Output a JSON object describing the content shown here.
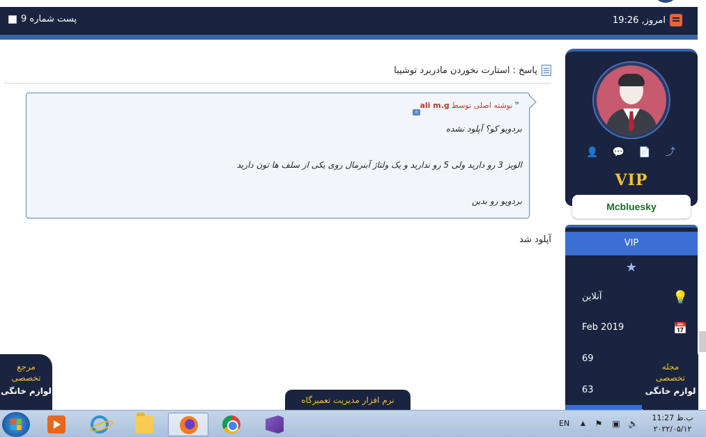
{
  "post": {
    "number_label": "پست شماره 9",
    "time_label": "امروز, 19:26"
  },
  "content": {
    "reply_title": "پاسخ : استارت نخوردن مادربرد توشیبا",
    "quote": {
      "header_prefix": "نوشته اصلی توسط",
      "author": "ali m.g",
      "lines": [
        "بردویو کو؟ آپلود نشده",
        "الویز 3 رو دارید ولی 5 رو ندارید و یک ولتاژ آبنرمال روی یکی از سلف ها تون دارید",
        "بردویو رو بدین"
      ]
    },
    "reply_body": "آپلود شد"
  },
  "user": {
    "rank_badge": "VIP",
    "username": "Mcbluesky",
    "actions": [
      "user-icon",
      "comments-icon",
      "document-icon",
      "share-icon"
    ],
    "rank_bar": "VIP",
    "status": "آنلاین",
    "join_date": "Feb 2019",
    "stat_a": "69",
    "stat_b": "63"
  },
  "floating": {
    "left": {
      "line1": "مرجع",
      "line2": "تخصصی",
      "line3": "لوازم خانگی"
    },
    "right": {
      "line1": "مجله",
      "line2": "تخصصی",
      "line3": "لوازم خانگی"
    },
    "bottom_banner": "نرم افزار مدیریت تعمیرگاه"
  },
  "taskbar": {
    "apps": [
      "windows-media-player",
      "internet-explorer",
      "file-explorer",
      "firefox",
      "chrome",
      "visual-studio"
    ],
    "active_app": "firefox",
    "language": "EN",
    "clock_time": "ب.ظ 11:27",
    "clock_date": "۲۰۲۲/۰۵/۱۲"
  },
  "colors": {
    "header_bg": "#1a2440",
    "accent_blue": "#3a64a8",
    "vip_gold": "#f2c12e",
    "username_green": "#1b6b2a",
    "quote_author_red": "#c0392b"
  }
}
